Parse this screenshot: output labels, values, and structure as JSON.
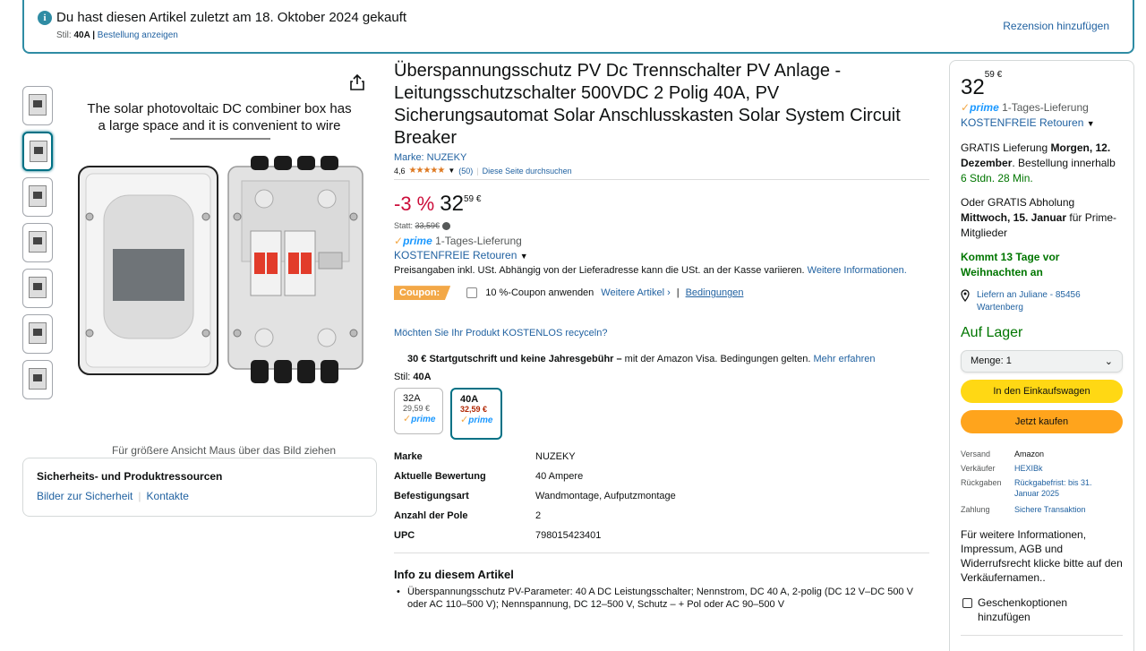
{
  "banner": {
    "title": "Du hast diesen Artikel zuletzt am 18. Oktober 2024 gekauft",
    "style_label": "Stil: ",
    "style_value": "40A",
    "style_sep": " | ",
    "order_link": "Bestellung anzeigen",
    "review_link": "Rezension hinzufügen"
  },
  "gallery": {
    "caption": "The solar photovoltaic DC combiner box has a large space and it is convenient to wire",
    "hover_hint": "Für größere Ansicht Maus über das Bild ziehen",
    "thumb_count": 7
  },
  "safety": {
    "heading": "Sicherheits- und Produktressourcen",
    "link1": "Bilder zur Sicherheit",
    "sep": "|",
    "link2": "Kontakte"
  },
  "product": {
    "title": "Überspannungsschutz PV Dc Trennschalter PV Anlage - Leitungsschutzschalter 500VDC 2 Polig 40A, PV Sicherungsautomat Solar Anschlusskasten Solar System Circuit Breaker",
    "brand": "Marke: NUZEKY",
    "rating": "4,6",
    "stars": "★★★★★",
    "rating_count": "(50)",
    "search_link": "Diese Seite durchsuchen",
    "discount": "-3 %",
    "price_whole": "32",
    "price_fraction": "59 €",
    "was_label": "Statt: ",
    "was_price": "33,59€",
    "prime_label": "prime",
    "delivery": " 1-Tages-Lieferung",
    "returns": "KOSTENFREIE Retouren",
    "tax_text": "Preisangaben inkl. USt. Abhängig von der Lieferadresse kann die USt. an der Kasse variieren. ",
    "tax_link": "Weitere Informationen.",
    "coupon_badge": "Coupon:",
    "coupon_text": "10 %-Coupon anwenden",
    "coupon_more": "Weitere Artikel ›",
    "coupon_terms": "Bedingungen",
    "recycle": "Möchten Sie Ihr Produkt KOSTENLOS recyceln?",
    "visa_bold": "30 € Startgutschrift und keine Jahresgebühr –",
    "visa_text": " mit der Amazon Visa. Bedingungen gelten. ",
    "visa_link": "Mehr erfahren",
    "style_label": "Stil: ",
    "style_value": "40A",
    "variants": [
      {
        "name": "32A",
        "price": "29,59 €",
        "prime": "prime"
      },
      {
        "name": "40A",
        "price": "32,59 €",
        "prime": "prime"
      }
    ],
    "specs": [
      {
        "k": "Marke",
        "v": "NUZEKY"
      },
      {
        "k": "Aktuelle Bewertung",
        "v": "40 Ampere"
      },
      {
        "k": "Befestigungsart",
        "v": "Wandmontage, Aufputzmontage"
      },
      {
        "k": "Anzahl der Pole",
        "v": "2"
      },
      {
        "k": "UPC",
        "v": "798015423401"
      }
    ],
    "info_heading": "Info zu diesem Artikel",
    "bullet1": "Überspannungsschutz PV-Parameter: 40 A DC Leistungsschalter; Nennstrom, DC 40 A, 2-polig (DC 12 V–DC 500 V oder AC 110–500 V); Nennspannung, DC 12–500 V, Schutz – + Pol oder AC 90–500 V"
  },
  "buybox": {
    "price_whole": "32",
    "price_fraction": "59 €",
    "prime_label": "prime",
    "delivery": " 1-Tages-Lieferung",
    "returns": "KOSTENFREIE Retouren",
    "free_delivery_pre": "GRATIS Lieferung ",
    "free_delivery_bold": "Morgen, 12. Dezember",
    "free_delivery_post": ". Bestellung innerhalb ",
    "countdown": "6 Stdn. 28 Min.",
    "pickup_pre": "Oder GRATIS Abholung ",
    "pickup_bold": "Mittwoch, 15. Januar",
    "pickup_post": " für Prime-Mitglieder",
    "christmas": "Kommt 13 Tage vor Weihnachten an",
    "location": "Liefern an Juliane - 85456 Wartenberg",
    "stock": "Auf Lager",
    "qty_label": "Menge: 1",
    "cart_btn": "In den Einkaufswagen",
    "buy_btn": "Jetzt kaufen",
    "rows": [
      {
        "k": "Versand",
        "v": "Amazon",
        "dark": true
      },
      {
        "k": "Verkäufer",
        "v": "HEXIBk",
        "dark": false
      },
      {
        "k": "Rückgaben",
        "v": "Rückgabefrist: bis 31. Januar 2025",
        "dark": false
      },
      {
        "k": "Zahlung",
        "v": "Sichere Transaktion",
        "dark": false
      }
    ],
    "more_info": "Für weitere Informationen, Impressum, AGB und Widerrufsrecht klicke bitte auf den Verkäufernamen..",
    "gift": "Geschenkoptionen hinzufügen"
  },
  "colors": {
    "link": "#2162a1",
    "discount": "#cc0c39",
    "stock": "#007600",
    "cart": "#ffd814",
    "buy": "#ffa41c",
    "banner_border": "#2f8ca4"
  }
}
